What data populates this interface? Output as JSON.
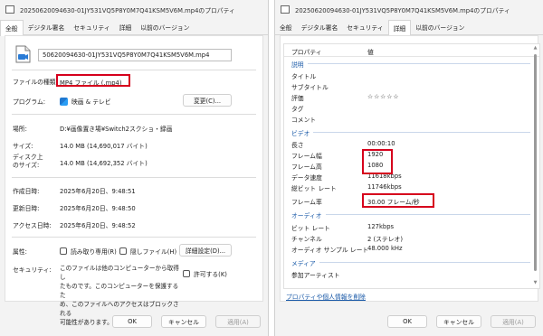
{
  "left": {
    "title": "20250620094630-01JY531VQ5P8Y0M7Q41KSM5V6M.mp4のプロパティ",
    "tabs": [
      "全般",
      "デジタル署名",
      "セキュリティ",
      "詳細",
      "以前のバージョン"
    ],
    "filename": "50620094630-01JY531VQ5P8Y0M7Q41KSM5V6M.mp4",
    "rows": {
      "filetype": {
        "label": "ファイルの種類:",
        "value": "MP4 ファイル (.mp4)"
      },
      "program": {
        "label": "プログラム:",
        "value": "映画 & テレビ",
        "button": "変更(C)..."
      },
      "location": {
        "label": "場所:",
        "value": "D:¥画像置き場¥Switch2スクショ・録画"
      },
      "size": {
        "label": "サイズ:",
        "value": "14.0 MB (14,690,017 バイト)"
      },
      "disksize": {
        "label1": "ディスク上",
        "label2": "のサイズ:",
        "value": "14.0 MB (14,692,352 バイト)"
      },
      "created": {
        "label": "作成日時:",
        "value": "2025年6月20日、9:48:51"
      },
      "modified": {
        "label": "更新日時:",
        "value": "2025年6月20日、9:48:50"
      },
      "accessed": {
        "label": "アクセス日時:",
        "value": "2025年6月20日、9:48:52"
      }
    },
    "attributes": {
      "label": "属性:",
      "readonly": "読み取り専用(R)",
      "hidden": "隠しファイル(H)",
      "advanced": "詳細設定(D)..."
    },
    "security": {
      "label": "セキュリティ:",
      "line1": "このファイルは他のコンピューターから取得し",
      "line2": "たものです。このコンピューターを保護するた",
      "line3": "め、このファイルへのアクセスはブロックされる",
      "line4": "可能性があります。",
      "allow": "許可する(K)"
    },
    "buttons": {
      "ok": "OK",
      "cancel": "キャンセル",
      "apply": "適用(A)"
    }
  },
  "right": {
    "title": "20250620094630-01JY531VQ5P8Y0M7Q41KSM5V6M.mp4のプロパティ",
    "tabs": [
      "全般",
      "デジタル署名",
      "セキュリティ",
      "詳細",
      "以前のバージョン"
    ],
    "header": {
      "property": "プロパティ",
      "value": "値"
    },
    "sections": {
      "description": "説明",
      "video": "ビデオ",
      "audio": "オーディオ",
      "media": "メディア"
    },
    "rows": {
      "title": {
        "k": "タイトル",
        "v": ""
      },
      "subtitle": {
        "k": "サブタイトル",
        "v": ""
      },
      "rating": {
        "k": "評価",
        "v": "☆☆☆☆☆"
      },
      "tags": {
        "k": "タグ",
        "v": ""
      },
      "comments": {
        "k": "コメント",
        "v": ""
      },
      "length": {
        "k": "長さ",
        "v": "00:00:10"
      },
      "width": {
        "k": "フレーム幅",
        "v": "1920"
      },
      "height": {
        "k": "フレーム高",
        "v": "1080"
      },
      "datarate": {
        "k": "データ速度",
        "v": "11618kbps"
      },
      "totalbitrate": {
        "k": "総ビット レート",
        "v": "11746kbps"
      },
      "framerate": {
        "k": "フレーム率",
        "v": "30.00 フレーム/秒"
      },
      "bitrate": {
        "k": "ビット レート",
        "v": "127kbps"
      },
      "channels": {
        "k": "チャンネル",
        "v": "2 (ステレオ)"
      },
      "samplerate": {
        "k": "オーディオ サンプル レート",
        "v": "48.000 kHz"
      },
      "contributing": {
        "k": "参加アーティスト",
        "v": ""
      }
    },
    "link": "プロパティや個人情報を削除",
    "buttons": {
      "ok": "OK",
      "cancel": "キャンセル",
      "apply": "適用(A)"
    }
  },
  "colors": {
    "highlight": "#d6001c",
    "link": "#1a5aa8",
    "section": "#1a5aa8"
  }
}
